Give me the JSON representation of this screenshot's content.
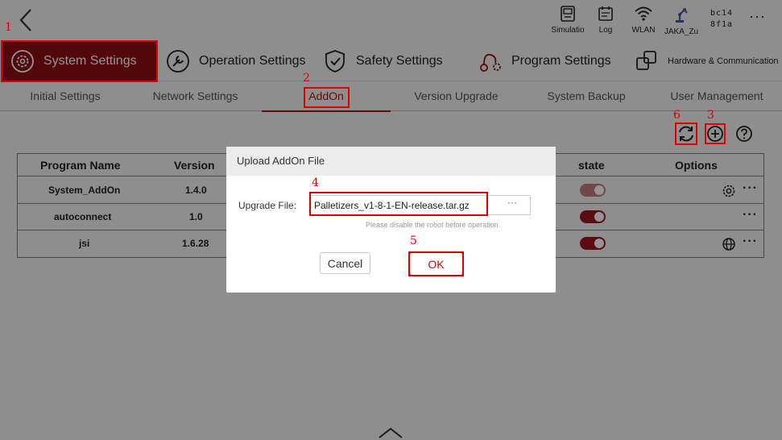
{
  "colors": {
    "accent": "#b0101a",
    "active_nav": "#8e0d14",
    "annotation": "#e00000"
  },
  "topbar": {
    "back_icon": "chevron-left-icon",
    "icons": [
      {
        "name": "simulation",
        "label": "Simulatio",
        "icon": "monitor-icon"
      },
      {
        "name": "log",
        "label": "Log",
        "icon": "log-icon"
      },
      {
        "name": "wlan",
        "label": "WLAN",
        "icon": "wifi-icon"
      },
      {
        "name": "robot",
        "label": "JAKA_Zu",
        "icon": "robot-arm-icon"
      }
    ],
    "serial_line1": "bc14",
    "serial_line2": "8f1a",
    "more": "···"
  },
  "main_nav": [
    {
      "label": "System Settings",
      "icon": "gear-circle-icon",
      "active": true
    },
    {
      "label": "Operation Settings",
      "icon": "wrench-icon",
      "active": false
    },
    {
      "label": "Safety Settings",
      "icon": "shield-check-icon",
      "active": false
    },
    {
      "label": "Program Settings",
      "icon": "program-icon",
      "active": false
    },
    {
      "label": "Hardware & Communication",
      "icon": "hardware-icon",
      "active": false
    }
  ],
  "sub_nav": [
    {
      "label": "Initial Settings",
      "active": false
    },
    {
      "label": "Network Settings",
      "active": false
    },
    {
      "label": "AddOn",
      "active": true
    },
    {
      "label": "Version Upgrade",
      "active": false
    },
    {
      "label": "System Backup",
      "active": false
    },
    {
      "label": "User Management",
      "active": false
    }
  ],
  "toolbar": {
    "refresh_icon": "refresh-icon",
    "add_icon": "plus-circle-icon",
    "help_icon": "question-circle-icon"
  },
  "table": {
    "headers": {
      "program_name": "Program Name",
      "version": "Version",
      "state": "state",
      "options": "Options"
    },
    "rows": [
      {
        "name": "System_AddOn",
        "version": "1.4.0",
        "state_on": true,
        "state_dim": true,
        "option_icon": "gear-icon",
        "more": "···"
      },
      {
        "name": "autoconnect",
        "version": "1.0",
        "state_on": true,
        "state_dim": false,
        "option_icon": "",
        "more": "···"
      },
      {
        "name": "jsi",
        "version": "1.6.28",
        "state_on": true,
        "state_dim": false,
        "option_icon": "globe-icon",
        "more": "···"
      }
    ]
  },
  "dialog": {
    "title": "Upload AddOn File",
    "field_label": "Upgrade File:",
    "file_value": "Palletizers_v1-8-1-EN-release.tar.gz",
    "browse": "···",
    "hint": "Please disable the robot before operation.",
    "cancel": "Cancel",
    "ok": "OK"
  },
  "annotations": [
    "1",
    "2",
    "3",
    "4",
    "5",
    "6"
  ]
}
